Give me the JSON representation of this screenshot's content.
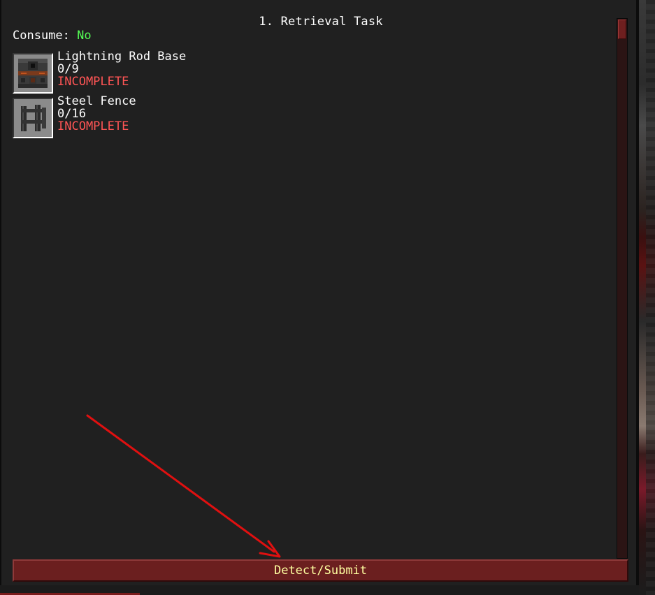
{
  "quest": {
    "title": "1. Retrieval Task",
    "consume_label": "Consume:",
    "consume_value": "No"
  },
  "items": [
    {
      "name": "Lightning Rod Base",
      "progress": "0/9",
      "status": "INCOMPLETE",
      "icon": "lightning-rod-base-icon"
    },
    {
      "name": "Steel Fence",
      "progress": "0/16",
      "status": "INCOMPLETE",
      "icon": "steel-fence-icon"
    }
  ],
  "submit": {
    "label": "Detect/Submit"
  },
  "colors": {
    "panel_bg": "#202020",
    "consume_yes_no": "#55ff55",
    "incomplete": "#ff5555",
    "button_bg": "#6b1f1f",
    "button_text": "#ffffa0",
    "annotation_arrow": "#e01010"
  }
}
